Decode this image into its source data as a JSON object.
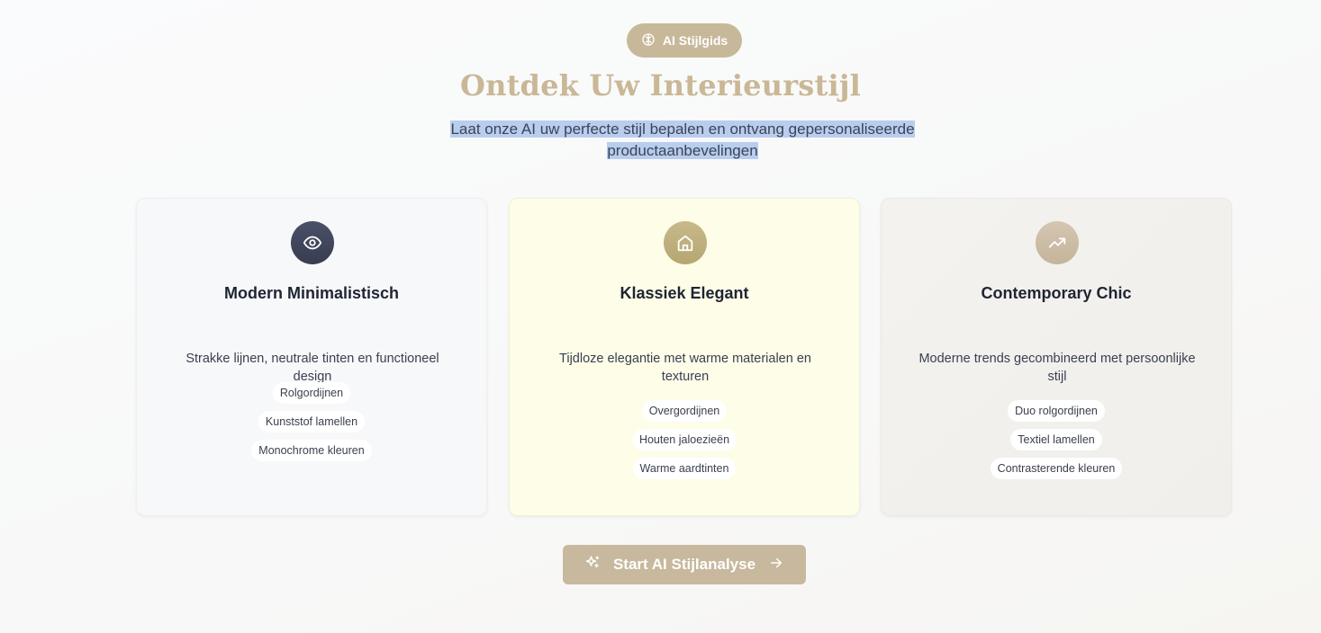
{
  "badge": {
    "label": "AI Stijlgids",
    "icon": "brain-icon"
  },
  "title": "Ontdek Uw Interieurstijl",
  "subtitle_line1": "Laat onze AI uw perfecte stijl bepalen en ontvang gepersonaliseerde",
  "subtitle_line2": "productaanbevelingen",
  "cards": [
    {
      "icon": "eye-icon",
      "title": "Modern Minimalistisch",
      "description": "Strakke lijnen, neutrale tinten en functioneel design",
      "tags": [
        "Rolgordijnen",
        "Kunststof lamellen",
        "Monochrome kleuren"
      ]
    },
    {
      "icon": "home-icon",
      "title": "Klassiek Elegant",
      "description": "Tijdloze elegantie met warme materialen en texturen",
      "tags": [
        "Overgordijnen",
        "Houten jaloezieën",
        "Warme aardtinten"
      ]
    },
    {
      "icon": "trending-up-icon",
      "title": "Contemporary Chic",
      "description": "Moderne trends gecombineerd met persoonlijke stijl",
      "tags": [
        "Duo rolgordijnen",
        "Textiel lamellen",
        "Contrasterende kleuren"
      ]
    }
  ],
  "cta": {
    "label": "Start AI Stijlanalyse",
    "icon_left": "sparkles-icon",
    "icon_right": "arrow-right-icon"
  },
  "colors": {
    "accent": "#c8b89d",
    "title": "#c9b796",
    "dark_icon": "#3f445a",
    "highlight": "#b9cdef"
  }
}
